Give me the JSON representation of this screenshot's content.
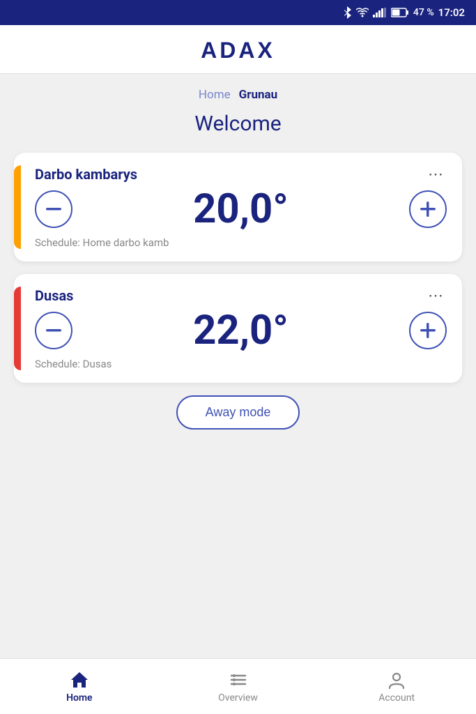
{
  "status_bar": {
    "battery": "47 %",
    "time": "17:02"
  },
  "header": {
    "logo": "ADAX"
  },
  "breadcrumb": {
    "home_label": "Home",
    "active_label": "Grunau"
  },
  "welcome": {
    "title": "Welcome"
  },
  "devices": [
    {
      "id": "darbo",
      "name": "Darbo kambarys",
      "temperature": "20,0°",
      "schedule": "Schedule: Home darbo kamb",
      "accent_color": "yellow"
    },
    {
      "id": "dusas",
      "name": "Dusas",
      "temperature": "22,0°",
      "schedule": "Schedule: Dusas",
      "accent_color": "orange-red"
    }
  ],
  "away_mode": {
    "label": "Away mode"
  },
  "bottom_nav": {
    "items": [
      {
        "id": "home",
        "label": "Home",
        "active": true
      },
      {
        "id": "overview",
        "label": "Overview",
        "active": false
      },
      {
        "id": "account",
        "label": "Account",
        "active": false
      }
    ]
  },
  "icons": {
    "bluetooth": "✦",
    "wifi": "▼",
    "signal": "▐",
    "battery": "▮",
    "minus": "−",
    "plus": "+",
    "more": "⋯"
  }
}
